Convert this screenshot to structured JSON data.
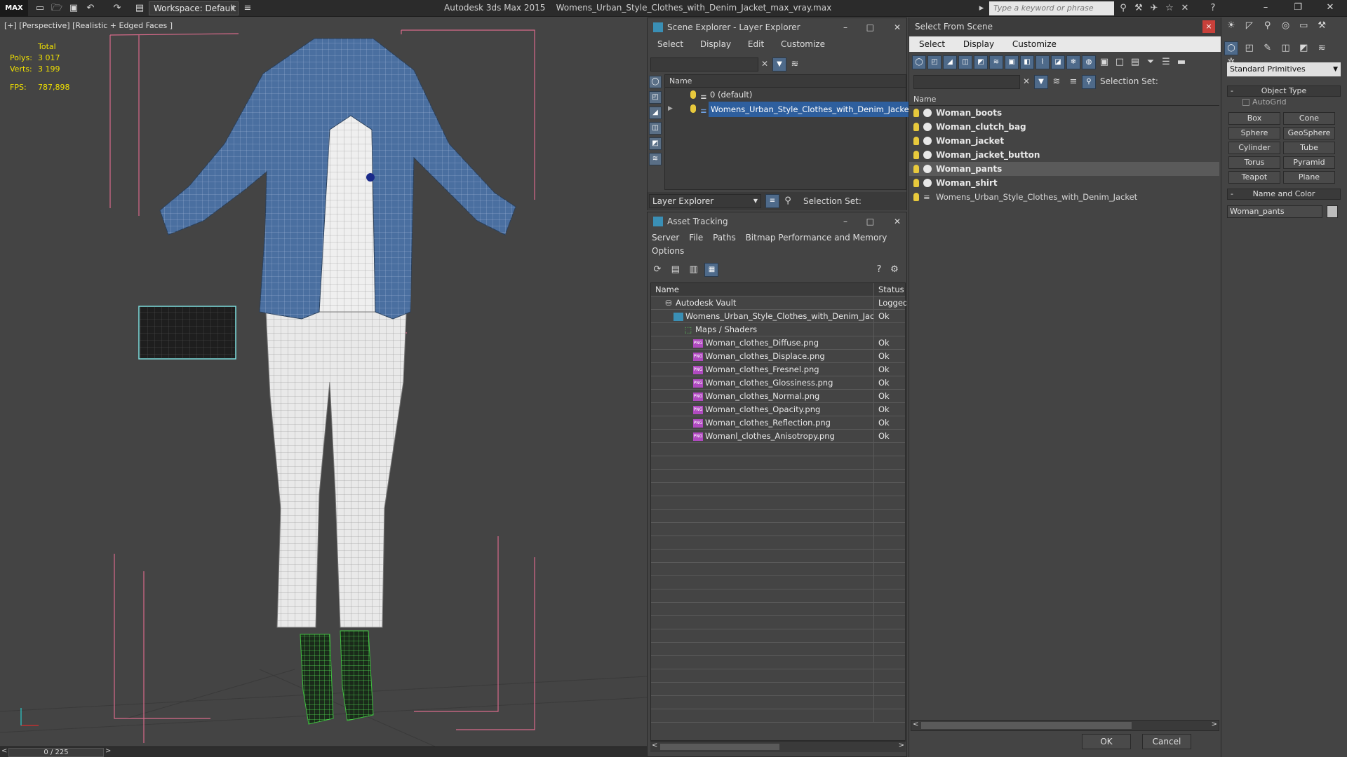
{
  "topbar": {
    "logo": "MAX",
    "workspace_label": "Workspace: Default",
    "title_app": "Autodesk 3ds Max  2015",
    "title_file": "Womens_Urban_Style_Clothes_with_Denim_Jacket_max_vray.max",
    "search_placeholder": "Type a keyword or phrase"
  },
  "viewport": {
    "label": "[+] [Perspective] [Realistic + Edged Faces ]",
    "stats": {
      "total_label": "Total",
      "polys_label": "Polys:",
      "polys_value": "3 017",
      "verts_label": "Verts:",
      "verts_value": "3 199",
      "fps_label": "FPS:",
      "fps_value": "787,898"
    },
    "timeline": "0 / 225"
  },
  "scene_explorer": {
    "title": "Scene Explorer - Layer Explorer",
    "menu": [
      "Select",
      "Display",
      "Edit",
      "Customize"
    ],
    "column_name": "Name",
    "layers": [
      "0 (default)",
      "Womens_Urban_Style_Clothes_with_Denim_Jacket"
    ],
    "explorer_select": "Layer Explorer",
    "selection_set_label": "Selection Set:"
  },
  "asset_tracking": {
    "title": "Asset Tracking",
    "menu": [
      "Server",
      "File",
      "Paths",
      "Bitmap Performance and Memory"
    ],
    "menu2": [
      "Options"
    ],
    "col_name": "Name",
    "col_status": "Status",
    "rows": [
      {
        "name": "Autodesk Vault",
        "status": "Logged",
        "indent": 1,
        "icon": "vault"
      },
      {
        "name": "Womens_Urban_Style_Clothes_with_Denim_Jac...",
        "status": "Ok",
        "indent": 2,
        "icon": "file"
      },
      {
        "name": "Maps / Shaders",
        "status": "",
        "indent": 3,
        "icon": "maps"
      },
      {
        "name": "Woman_clothes_Diffuse.png",
        "status": "Ok",
        "indent": 4,
        "icon": "png"
      },
      {
        "name": "Woman_clothes_Displace.png",
        "status": "Ok",
        "indent": 4,
        "icon": "png"
      },
      {
        "name": "Woman_clothes_Fresnel.png",
        "status": "Ok",
        "indent": 4,
        "icon": "png"
      },
      {
        "name": "Woman_clothes_Glossiness.png",
        "status": "Ok",
        "indent": 4,
        "icon": "png"
      },
      {
        "name": "Woman_clothes_Normal.png",
        "status": "Ok",
        "indent": 4,
        "icon": "png"
      },
      {
        "name": "Woman_clothes_Opacity.png",
        "status": "Ok",
        "indent": 4,
        "icon": "png"
      },
      {
        "name": "Woman_clothes_Reflection.png",
        "status": "Ok",
        "indent": 4,
        "icon": "png"
      },
      {
        "name": "Womanl_clothes_Anisotropy.png",
        "status": "Ok",
        "indent": 4,
        "icon": "png"
      }
    ]
  },
  "select_from_scene": {
    "title": "Select From Scene",
    "menu": [
      "Select",
      "Display",
      "Customize"
    ],
    "selection_set_label": "Selection Set:",
    "column_name": "Name",
    "objects": [
      {
        "name": "Woman_boots",
        "selected": false
      },
      {
        "name": "Woman_clutch_bag",
        "selected": false
      },
      {
        "name": "Woman_jacket",
        "selected": false
      },
      {
        "name": "Woman_jacket_button",
        "selected": false
      },
      {
        "name": "Woman_pants",
        "selected": true
      },
      {
        "name": "Woman_shirt",
        "selected": false
      }
    ],
    "group_row": "Womens_Urban_Style_Clothes_with_Denim_Jacket",
    "ok_label": "OK",
    "cancel_label": "Cancel"
  },
  "command_panel": {
    "category": "Standard Primitives",
    "object_type_label": "Object Type",
    "autogrid_label": "AutoGrid",
    "primitives": [
      "Box",
      "Cone",
      "Sphere",
      "GeoSphere",
      "Cylinder",
      "Tube",
      "Torus",
      "Pyramid",
      "Teapot",
      "Plane"
    ],
    "name_color_label": "Name and Color",
    "name_value": "Woman_pants"
  },
  "colors": {
    "stats_yellow": "#f0e000",
    "selection_blue": "#2e5f9e",
    "close_red": "#c8403a",
    "jacket_denim": "#4a6fa0",
    "boots_green": "#3fbf3f",
    "bbox_pink": "#d86a8a"
  }
}
